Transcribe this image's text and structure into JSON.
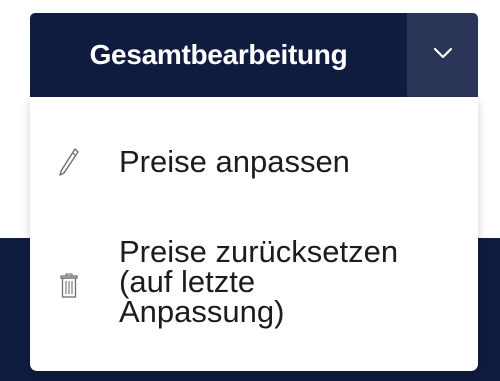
{
  "split_button": {
    "label": "Gesamtbearbeitung",
    "toggle_icon": "chevron-down-icon"
  },
  "dropdown": {
    "items": [
      {
        "label": "Preise anpassen",
        "icon": "pencil-icon"
      },
      {
        "label": "Preise zurücksetzen\n(auf letzte\nAnpassung)",
        "icon": "trash-icon"
      }
    ]
  },
  "colors": {
    "primary": "#0f1c3f",
    "toggle": "#2b3557",
    "text": "#1c1c1c",
    "icon": "#6e6e6e"
  }
}
